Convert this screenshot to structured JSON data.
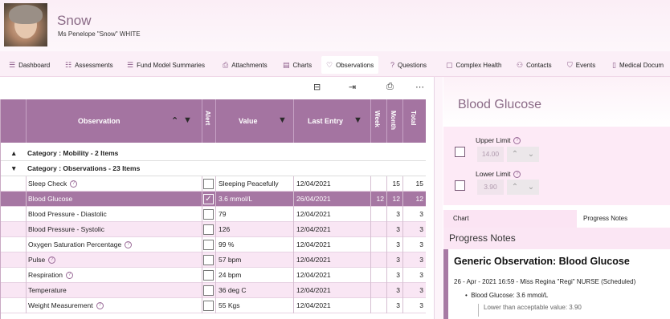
{
  "patient": {
    "nickname": "Snow",
    "full_name": "Ms Penelope \"Snow\" WHITE"
  },
  "tabs": [
    {
      "label": "Dashboard",
      "icon": "dashboard-icon"
    },
    {
      "label": "Assessments",
      "icon": "assessments-icon"
    },
    {
      "label": "Fund Model Summaries",
      "icon": "list-icon"
    },
    {
      "label": "Attachments",
      "icon": "paperclip-icon"
    },
    {
      "label": "Charts",
      "icon": "charts-icon"
    },
    {
      "label": "Observations",
      "icon": "heart-icon"
    },
    {
      "label": "Questions",
      "icon": "question-icon"
    },
    {
      "label": "Complex Health",
      "icon": "clipboard-icon"
    },
    {
      "label": "Contacts",
      "icon": "contacts-icon"
    },
    {
      "label": "Events",
      "icon": "shield-icon"
    },
    {
      "label": "Medical Docum",
      "icon": "document-icon"
    }
  ],
  "grid": {
    "headers": {
      "observation": "Observation",
      "alert": "Alert",
      "value": "Value",
      "last_entry": "Last Entry",
      "week": "Week",
      "month": "Month",
      "total": "Total"
    },
    "categories": {
      "mobility": "Category : Mobility - 2 Items",
      "observations": "Category : Observations - 23 Items"
    },
    "rows": [
      {
        "name": "Sleep Check",
        "info": true,
        "alert": false,
        "value": "Sleeping Peacefully",
        "last_entry": "12/04/2021",
        "week": "",
        "month": "15",
        "total": "15"
      },
      {
        "name": "Blood Glucose",
        "info": false,
        "alert": true,
        "value": "3.6 mmol/L",
        "last_entry": "26/04/2021",
        "week": "12",
        "month": "12",
        "total": "12"
      },
      {
        "name": "Blood Pressure - Diastolic",
        "info": false,
        "alert": false,
        "value": "79",
        "last_entry": "12/04/2021",
        "week": "",
        "month": "3",
        "total": "3"
      },
      {
        "name": "Blood Pressure - Systolic",
        "info": false,
        "alert": false,
        "value": "126",
        "last_entry": "12/04/2021",
        "week": "",
        "month": "3",
        "total": "3"
      },
      {
        "name": "Oxygen Saturation Percentage",
        "info": true,
        "alert": false,
        "value": "99 %",
        "last_entry": "12/04/2021",
        "week": "",
        "month": "3",
        "total": "3"
      },
      {
        "name": "Pulse",
        "info": true,
        "alert": false,
        "value": "57 bpm",
        "last_entry": "12/04/2021",
        "week": "",
        "month": "3",
        "total": "3"
      },
      {
        "name": "Respiration",
        "info": true,
        "alert": false,
        "value": "24 bpm",
        "last_entry": "12/04/2021",
        "week": "",
        "month": "3",
        "total": "3"
      },
      {
        "name": "Temperature",
        "info": false,
        "alert": false,
        "value": "36 deg C",
        "last_entry": "12/04/2021",
        "week": "",
        "month": "3",
        "total": "3"
      },
      {
        "name": "Weight Measurement",
        "info": true,
        "alert": false,
        "value": "55 Kgs",
        "last_entry": "12/04/2021",
        "week": "",
        "month": "3",
        "total": "3"
      }
    ]
  },
  "panel": {
    "title": "Blood Glucose",
    "upper_limit_label": "Upper Limit",
    "upper_limit_value": "14.00",
    "lower_limit_label": "Lower Limit",
    "lower_limit_value": "3.90",
    "subtabs": [
      "Chart",
      "Progress Notes"
    ],
    "progress_notes_title": "Progress Notes",
    "note": {
      "heading": "Generic Observation: Blood Glucose",
      "meta": "26 - Apr - 2021 16:59 - Miss Regina \"Regi\" NURSE (Scheduled)",
      "bullet": "Blood Glucose: 3.6 mmol/L",
      "detail": "Lower than acceptable value: 3.90"
    }
  }
}
